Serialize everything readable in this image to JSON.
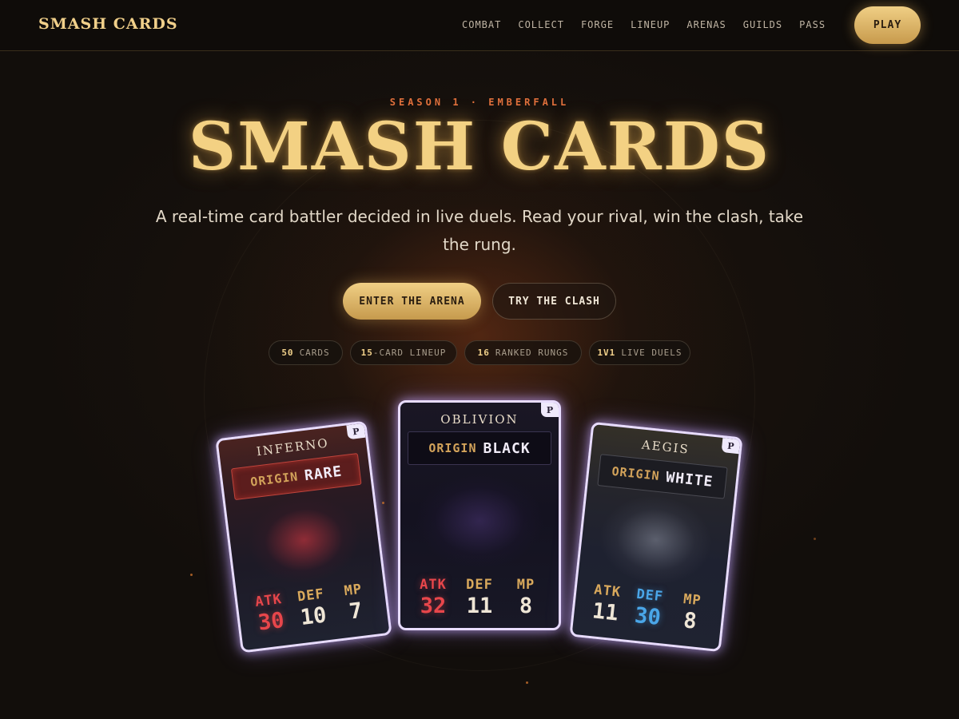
{
  "nav": {
    "logo": "SMASH CARDS",
    "links": [
      "COMBAT",
      "COLLECT",
      "FORGE",
      "LINEUP",
      "ARENAS",
      "GUILDS",
      "PASS"
    ],
    "play_label": "PLAY"
  },
  "hero": {
    "eyebrow": "SEASON 1 · EMBERFALL",
    "title": "SMASH CARDS",
    "tagline": "A real-time card battler decided in live duels. Read your rival, win the clash, take the rung.",
    "primary_cta": "ENTER THE ARENA",
    "secondary_cta": "TRY THE CLASH"
  },
  "stats_pills": [
    {
      "value": "50",
      "label": "CARDS"
    },
    {
      "value": "15",
      "label": "-CARD LINEUP"
    },
    {
      "value": "16",
      "label": "RANKED RUNGS"
    },
    {
      "value": "1V1",
      "label": "LIVE DUELS"
    }
  ],
  "cards": [
    {
      "name": "INFERNO",
      "badge": "P",
      "origin_label": "ORIGIN",
      "origin": "RARE",
      "stats": [
        {
          "label": "ATK",
          "value": "30"
        },
        {
          "label": "DEF",
          "value": "10"
        },
        {
          "label": "MP",
          "value": "7"
        }
      ]
    },
    {
      "name": "OBLIVION",
      "badge": "P",
      "origin_label": "ORIGIN",
      "origin": "BLACK",
      "stats": [
        {
          "label": "ATK",
          "value": "32"
        },
        {
          "label": "DEF",
          "value": "11"
        },
        {
          "label": "MP",
          "value": "8"
        }
      ]
    },
    {
      "name": "AEGIS",
      "badge": "P",
      "origin_label": "ORIGIN",
      "origin": "WHITE",
      "stats": [
        {
          "label": "ATK",
          "value": "11"
        },
        {
          "label": "DEF",
          "value": "30"
        },
        {
          "label": "MP",
          "value": "8"
        }
      ]
    }
  ],
  "colors": {
    "gold": "#f3d183",
    "ember": "#e0703c",
    "card_border": "#e8dcff",
    "attack_red": "#e7464b",
    "defense_blue": "#4aa6e8",
    "background": "#120e0b"
  }
}
